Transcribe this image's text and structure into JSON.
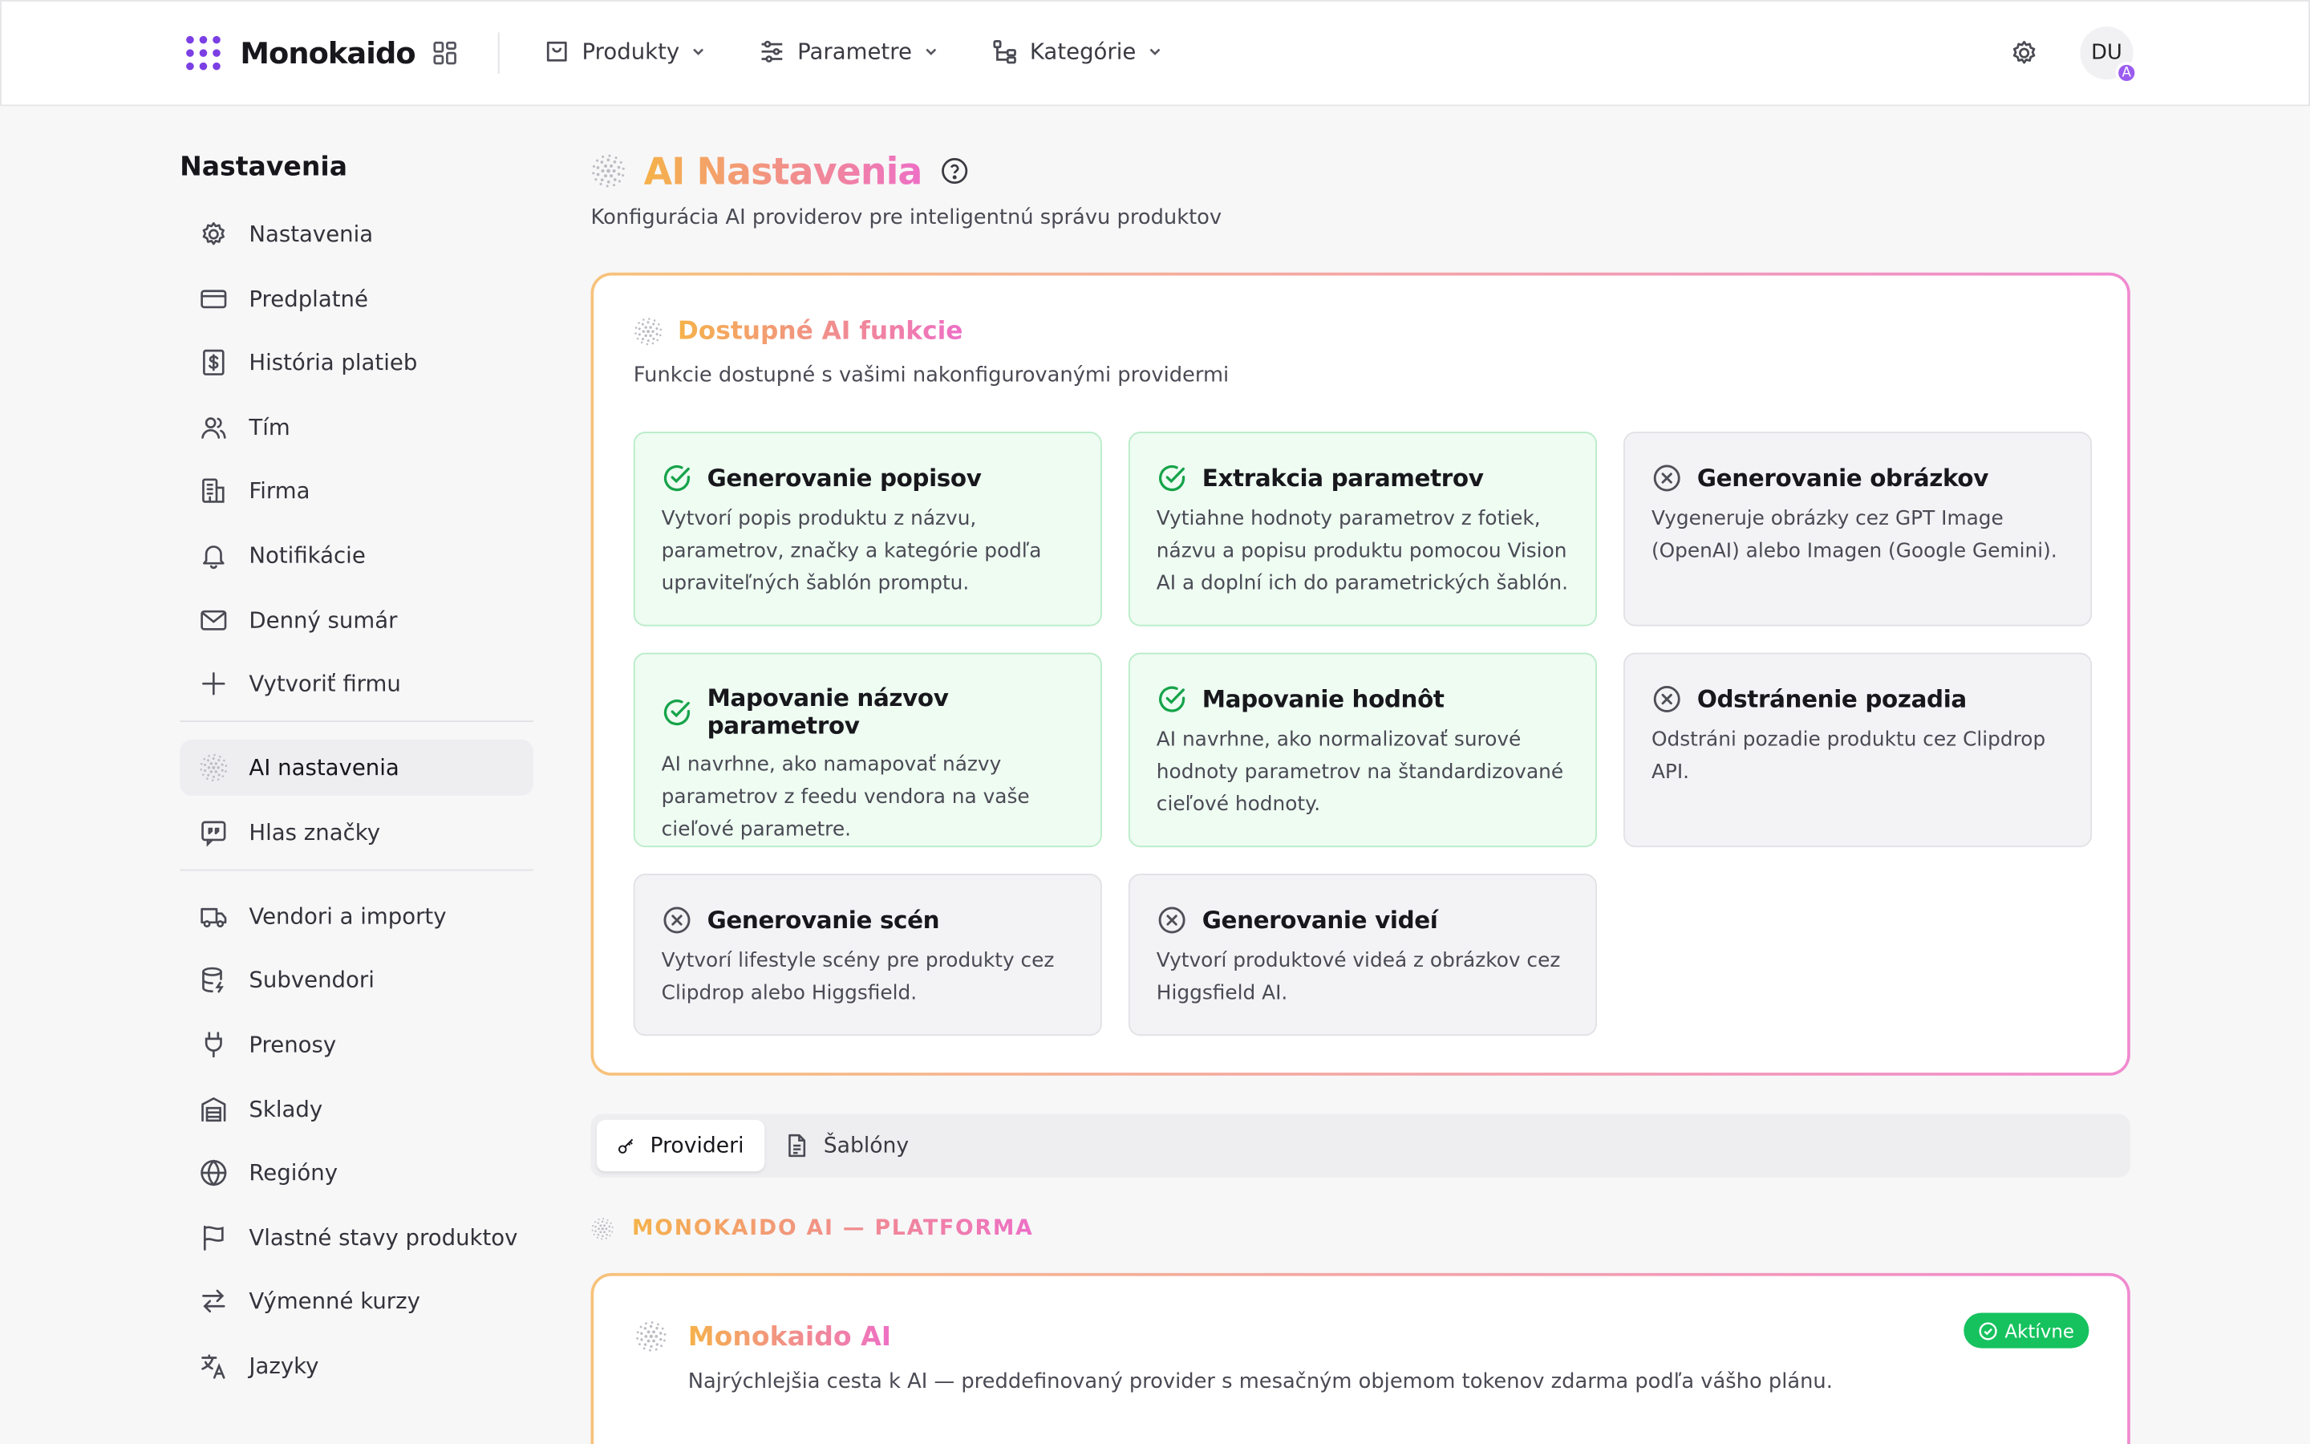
{
  "header": {
    "brand": "Monokaido",
    "nav": [
      {
        "label": "Produkty",
        "icon": "shopping-bag-icon"
      },
      {
        "label": "Parametre",
        "icon": "sliders-icon"
      },
      {
        "label": "Kategórie",
        "icon": "tree-icon"
      }
    ],
    "avatar_initials": "DU",
    "avatar_badge": "A"
  },
  "sidebar": {
    "title": "Nastavenia",
    "groups": [
      [
        {
          "label": "Nastavenia",
          "icon": "gear-icon"
        },
        {
          "label": "Predplatné",
          "icon": "credit-card-icon"
        },
        {
          "label": "História platieb",
          "icon": "receipt-icon"
        },
        {
          "label": "Tím",
          "icon": "users-icon"
        },
        {
          "label": "Firma",
          "icon": "building-icon"
        },
        {
          "label": "Notifikácie",
          "icon": "bell-icon"
        },
        {
          "label": "Denný sumár",
          "icon": "mail-icon"
        },
        {
          "label": "Vytvoriť firmu",
          "icon": "plus-icon"
        }
      ],
      [
        {
          "label": "AI nastavenia",
          "icon": "ai-sparkle-icon",
          "active": true
        },
        {
          "label": "Hlas značky",
          "icon": "quote-icon"
        }
      ],
      [
        {
          "label": "Vendori a importy",
          "icon": "truck-icon"
        },
        {
          "label": "Subvendori",
          "icon": "database-icon"
        },
        {
          "label": "Prenosy",
          "icon": "plug-icon"
        },
        {
          "label": "Sklady",
          "icon": "warehouse-icon"
        },
        {
          "label": "Regióny",
          "icon": "globe-icon"
        },
        {
          "label": "Vlastné stavy produktov",
          "icon": "flag-icon"
        },
        {
          "label": "Výmenné kurzy",
          "icon": "exchange-icon"
        },
        {
          "label": "Jazyky",
          "icon": "translate-icon"
        }
      ]
    ]
  },
  "page": {
    "title": "AI Nastavenia",
    "subtitle": "Konfigurácia AI providerov pre inteligentnú správu produktov"
  },
  "features": {
    "title": "Dostupné AI funkcie",
    "subtitle": "Funkcie dostupné s vašimi nakonfigurovanými providermi",
    "items": [
      {
        "title": "Generovanie popisov",
        "desc": "Vytvorí popis produktu z názvu, parametrov, značky a kategórie podľa upraviteľných šablón promptu.",
        "enabled": true
      },
      {
        "title": "Extrakcia parametrov",
        "desc": "Vytiahne hodnoty parametrov z fotiek, názvu a popisu produktu pomocou Vision AI a doplní ich do parametrických šablón.",
        "enabled": true
      },
      {
        "title": "Generovanie obrázkov",
        "desc": "Vygeneruje obrázky cez GPT Image (OpenAI) alebo Imagen (Google Gemini).",
        "enabled": false
      },
      {
        "title": "Mapovanie názvov parametrov",
        "desc": "AI navrhne, ako namapovať názvy parametrov z feedu vendora na vaše cieľové parametre.",
        "enabled": true
      },
      {
        "title": "Mapovanie hodnôt",
        "desc": "AI navrhne, ako normalizovať surové hodnoty parametrov na štandardizované cieľové hodnoty.",
        "enabled": true
      },
      {
        "title": "Odstránenie pozadia",
        "desc": "Odstráni pozadie produktu cez Clipdrop API.",
        "enabled": false
      },
      {
        "title": "Generovanie scén",
        "desc": "Vytvorí lifestyle scény pre produkty cez Clipdrop alebo Higgsfield.",
        "enabled": false
      },
      {
        "title": "Generovanie videí",
        "desc": "Vytvorí produktové videá z obrázkov cez Higgsfield AI.",
        "enabled": false
      }
    ]
  },
  "tabs": [
    {
      "label": "Provideri",
      "icon": "key-icon",
      "active": true
    },
    {
      "label": "Šablóny",
      "icon": "document-icon",
      "active": false
    }
  ],
  "platform": {
    "section_label": "MONOKAIDO AI — PLATFORMA",
    "provider_name": "Monokaido AI",
    "provider_desc": "Najrýchlejšia cesta k AI — preddefinovaný provider s mesačným objemom tokenov zdarma podľa vášho plánu.",
    "status": "Aktívne"
  },
  "colors": {
    "accent_gradient_start": "#f5b24a",
    "accent_gradient_end": "#ee6fc6",
    "enabled_bg": "#eefcf2",
    "enabled_icon": "#16a34a",
    "disabled_bg": "#f3f3f6",
    "status_active": "#16c25e",
    "brand_purple": "#7b3fe4"
  }
}
